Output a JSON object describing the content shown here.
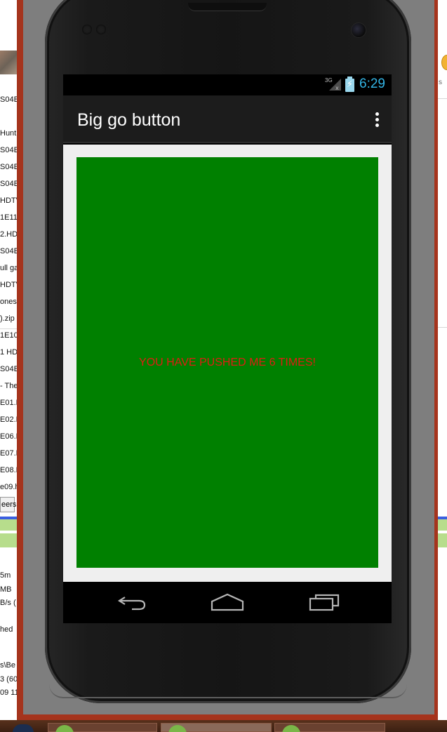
{
  "background": {
    "left_rows": [
      "S04E0",
      "Hunt",
      "S04E0",
      "S04E0",
      "S04E0",
      "HDTV",
      "1E11",
      "2.HD",
      "S04E0",
      "ull ga",
      "HDTV",
      "ones",
      ").zip",
      "1E10",
      "1 HD",
      "S04E0",
      "- The",
      "E02.H",
      "E01.H",
      "E06.H",
      "E07.H",
      "E08.H",
      "e09.h"
    ],
    "bottom_rows": [
      "5m",
      "MB",
      "B/s (",
      "hed",
      "s\\Be",
      "3 (60",
      "09 11"
    ],
    "tab_label": "eers",
    "right_text": "s"
  },
  "phone": {
    "status_bar": {
      "network": "3G",
      "time": "6:29",
      "accent_color": "#33b5e5"
    },
    "action_bar": {
      "title": "Big go button"
    },
    "content": {
      "button_label": "YOU HAVE PUSHED ME 6 TIMES!",
      "button_color": "#008000",
      "label_color": "#e01c12"
    },
    "nav_bar": {
      "back": "back-icon",
      "home": "home-icon",
      "recents": "recents-icon"
    }
  }
}
